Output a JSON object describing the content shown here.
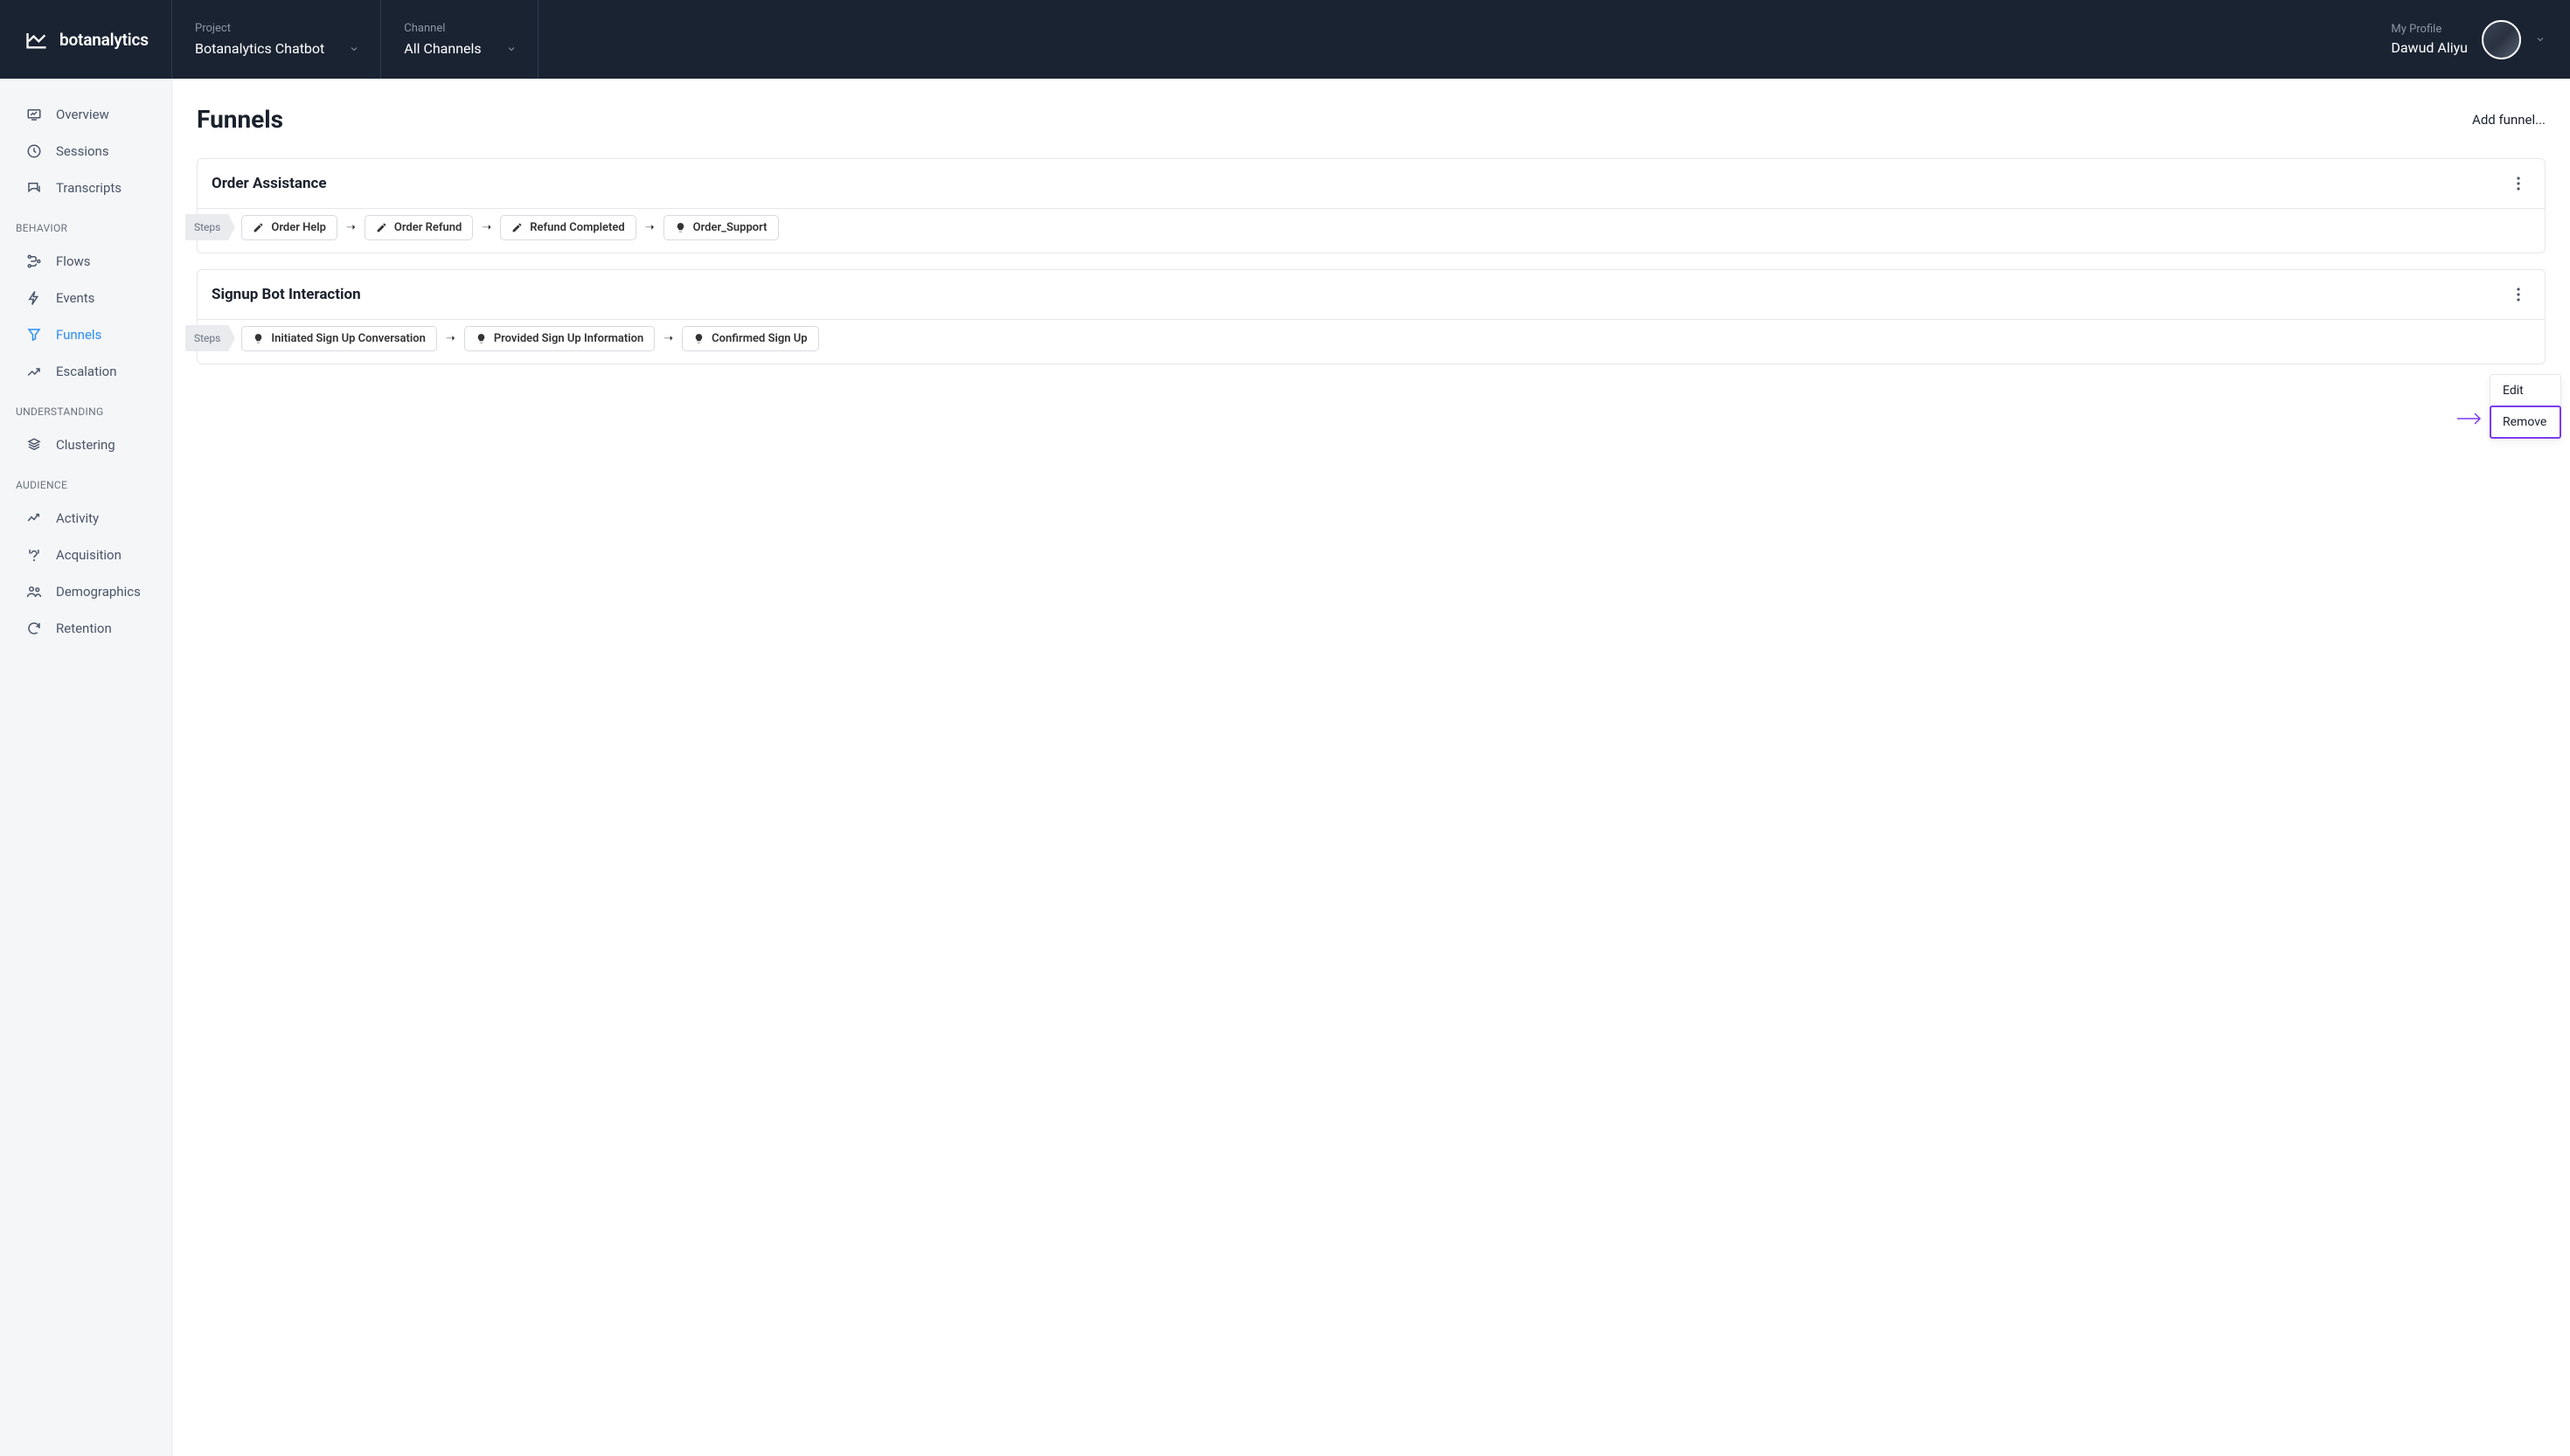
{
  "brand": "botanalytics",
  "header": {
    "project_label": "Project",
    "project_value": "Botanalytics Chatbot",
    "channel_label": "Channel",
    "channel_value": "All Channels",
    "profile_label": "My Profile",
    "profile_name": "Dawud Aliyu"
  },
  "sidebar": {
    "top": [
      {
        "label": "Overview",
        "icon": "overview"
      },
      {
        "label": "Sessions",
        "icon": "sessions"
      },
      {
        "label": "Transcripts",
        "icon": "transcripts"
      }
    ],
    "sections": [
      {
        "title": "BEHAVIOR",
        "items": [
          {
            "label": "Flows",
            "icon": "flows"
          },
          {
            "label": "Events",
            "icon": "events"
          },
          {
            "label": "Funnels",
            "icon": "funnels",
            "active": true
          },
          {
            "label": "Escalation",
            "icon": "escalation"
          }
        ]
      },
      {
        "title": "UNDERSTANDING",
        "items": [
          {
            "label": "Clustering",
            "icon": "clustering"
          }
        ]
      },
      {
        "title": "AUDIENCE",
        "items": [
          {
            "label": "Activity",
            "icon": "activity"
          },
          {
            "label": "Acquisition",
            "icon": "acquisition"
          },
          {
            "label": "Demographics",
            "icon": "demographics"
          },
          {
            "label": "Retention",
            "icon": "retention"
          }
        ]
      }
    ]
  },
  "page": {
    "title": "Funnels",
    "add_label": "Add funnel..."
  },
  "funnels": [
    {
      "name": "Order Assistance",
      "steps_label": "Steps",
      "steps": [
        {
          "label": "Order Help",
          "type": "pen"
        },
        {
          "label": "Order Refund",
          "type": "pen"
        },
        {
          "label": "Refund Completed",
          "type": "pen"
        },
        {
          "label": "Order_Support",
          "type": "bulb"
        }
      ]
    },
    {
      "name": "Signup Bot Interaction",
      "steps_label": "Steps",
      "steps": [
        {
          "label": "Initiated Sign Up Conversation",
          "type": "bulb"
        },
        {
          "label": "Provided Sign Up Information",
          "type": "bulb"
        },
        {
          "label": "Confirmed Sign Up",
          "type": "bulb"
        }
      ]
    }
  ],
  "context_menu": {
    "edit": "Edit",
    "remove": "Remove"
  }
}
